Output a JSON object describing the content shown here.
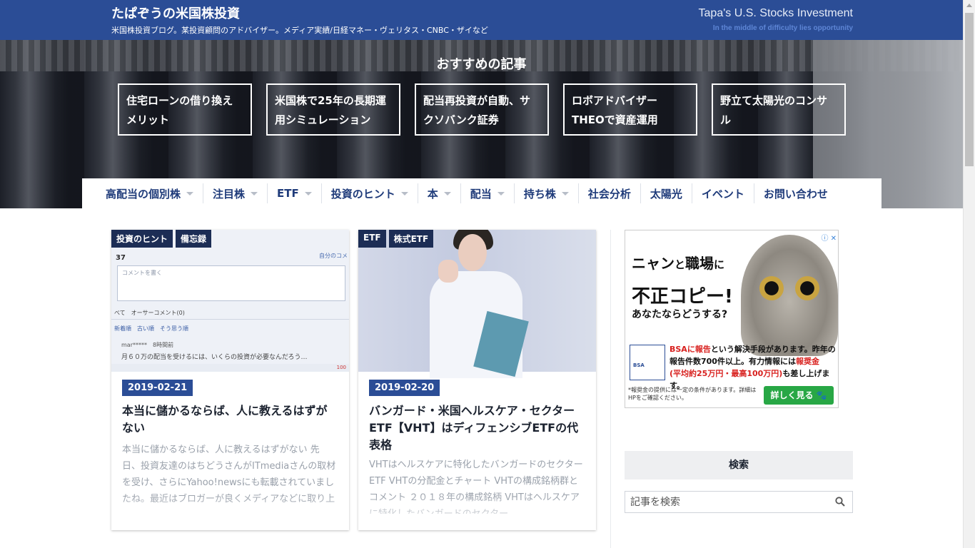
{
  "header": {
    "title": "たぱぞうの米国株投資",
    "description": "米国株投資ブログ。某投資顧問のアドバイザー。メディア実績/日経マネー・ヴェリタス・CNBC・ザイなど",
    "title_en": "Tapa's U.S. Stocks Investment",
    "tagline": "In the middle of difficulty lies opportunity"
  },
  "recommended": {
    "heading": "おすすめの記事",
    "items": [
      "住宅ローンの借り換えメリット",
      "米国株で25年の長期運用シミュレーション",
      "配当再投資が自動、サクソバンク証券",
      "ロボアドバイザーTHEOで資産運用",
      "野立て太陽光のコンサル"
    ]
  },
  "nav": {
    "items": [
      {
        "label": "高配当の個別株",
        "dropdown": true
      },
      {
        "label": "注目株",
        "dropdown": true
      },
      {
        "label": "ETF",
        "dropdown": true
      },
      {
        "label": "投資のヒント",
        "dropdown": true
      },
      {
        "label": "本",
        "dropdown": true
      },
      {
        "label": "配当",
        "dropdown": true
      },
      {
        "label": "持ち株",
        "dropdown": true
      },
      {
        "label": "社会分析",
        "dropdown": false
      },
      {
        "label": "太陽光",
        "dropdown": false
      },
      {
        "label": "イベント",
        "dropdown": false
      },
      {
        "label": "お問い合わせ",
        "dropdown": false
      }
    ]
  },
  "posts": [
    {
      "tags": [
        "投資のヒント",
        "備忘録"
      ],
      "date": "2019-02-21",
      "title": "本当に儲かるならば、人に教えるはずがない",
      "excerpt": "本当に儲かるならば、人に教えるはずがない 先日、投資友達のはちどうさんがITmediaさんの取材を受け、さらにYahoo!newsにも転載されていましたね。最近はブロガーが良くメディアなどに取り上げられるようになりました。",
      "thumb": {
        "count": "37",
        "link": "自分のコメ",
        "comment_placeholder": "コメントを書く",
        "tabs": "べて　オーサーコメント(0)",
        "sort": "新着順　古い順　そう思う順",
        "user": "mar*****　8時間前",
        "comment": "月６０万の配当を受けるには、いくらの投資が必要なんだろう…",
        "score": "100"
      }
    },
    {
      "tags": [
        "ETF",
        "株式ETF"
      ],
      "date": "2019-02-20",
      "title": "バンガード・米国ヘルスケア・セクターETF【VHT】はディフェンシブETFの代表格",
      "excerpt": "VHTはヘルスケアに特化したバンガードのセクターETF VHTの分配金とチャート VHTの構成銘柄群とコメント ２０１８年の構成銘柄 VHTはヘルスケアに特化したバンガードのセクター"
    }
  ],
  "ad": {
    "line1_a": "ニャン",
    "line1_b": "と",
    "line1_c": "職場",
    "line1_d": "に",
    "line2": "不正コピー!",
    "line3": "あなたならどうする?",
    "logo": "BSA",
    "body_red1": "BSAに報告",
    "body_1": "という解決手段があります。昨年の報告件数700件以上。有力情報には",
    "body_red2": "報奨金",
    "body_red3": "(平均約25万円・最高100万円)",
    "body_2": "も差し上げます。",
    "note": "*報奨金の提供には一定の条件があります。詳細はHPをご確認ください。",
    "button": "詳しく見る 🐾",
    "info": "ⓘ ✕"
  },
  "sidebar": {
    "search_title": "検索",
    "search_placeholder": "記事を検索"
  },
  "colors": {
    "header_bg": "#2b4d96",
    "tag_bg": "#1c2d55",
    "date_bg": "#2b4d96",
    "nav_text": "#1f3b7a",
    "ad_button": "#28a745"
  }
}
